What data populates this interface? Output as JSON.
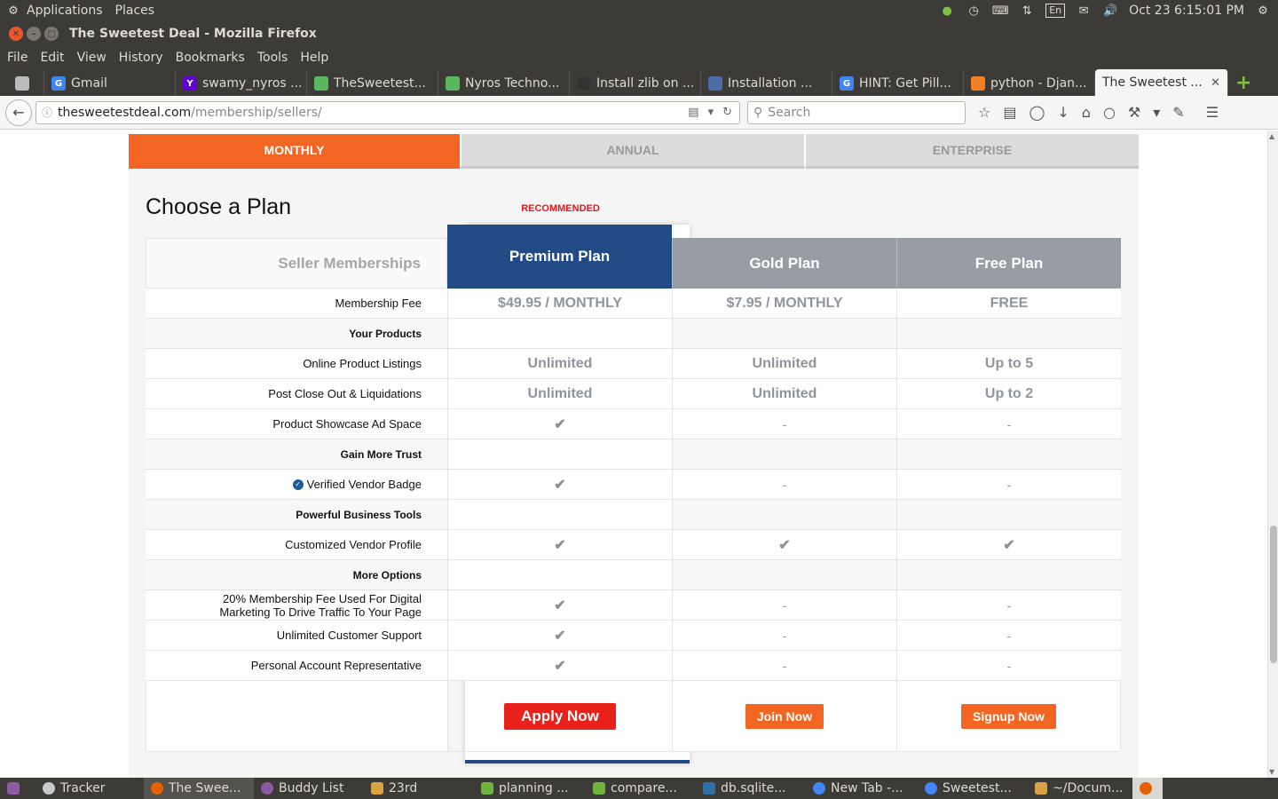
{
  "panel": {
    "menus": [
      "Applications",
      "Places"
    ],
    "keyboard_layout": "En",
    "datetime": "Oct 23  6:15:01 PM"
  },
  "window": {
    "title": "The Sweetest Deal - Mozilla Firefox"
  },
  "menubar": [
    "File",
    "Edit",
    "View",
    "History",
    "Bookmarks",
    "Tools",
    "Help"
  ],
  "tabs": [
    {
      "label": "Gmail",
      "icon": "google-icon",
      "color": "#4285f4"
    },
    {
      "label": "swamy_nyros ...",
      "icon": "yahoo-icon",
      "color": "#5f01d1"
    },
    {
      "label": "TheSweetest...",
      "icon": "cloud-icon",
      "color": "#5cb85c"
    },
    {
      "label": "Nyros Techno...",
      "icon": "cloud-icon",
      "color": "#5cb85c"
    },
    {
      "label": "Install zlib on ...",
      "icon": "github-icon",
      "color": "#333333"
    },
    {
      "label": "Installation ...",
      "icon": "doc-icon",
      "color": "#4a6da7"
    },
    {
      "label": "HINT: Get Pill...",
      "icon": "google-icon",
      "color": "#4285f4"
    },
    {
      "label": "python - Djan...",
      "icon": "stackoverflow-icon",
      "color": "#f48024"
    },
    {
      "label": "The Sweetest ...",
      "icon": "page-icon",
      "color": "#999999"
    }
  ],
  "navbar": {
    "url_domain": "thesweetestdeal.com",
    "url_path": "/membership/sellers/",
    "search_placeholder": "Search"
  },
  "plan_tabs": [
    "MONTHLY",
    "ANNUAL",
    "ENTERPRISE"
  ],
  "choose_title": "Choose a Plan",
  "recommended": "RECOMMENDED",
  "table": {
    "header": {
      "label": "Seller Memberships",
      "plans": [
        "Premium Plan",
        "Gold Plan",
        "Free Plan"
      ]
    },
    "rows": [
      {
        "label": "Membership Fee",
        "values": [
          "$49.95 / MONTHLY",
          "$7.95 / MONTHLY",
          "FREE"
        ]
      },
      {
        "label": "Your Products",
        "section": true
      },
      {
        "label": "Online Product Listings",
        "values": [
          "Unlimited",
          "Unlimited",
          "Up to 5"
        ]
      },
      {
        "label": "Post Close Out & Liquidations",
        "values": [
          "Unlimited",
          "Unlimited",
          "Up to 2"
        ]
      },
      {
        "label": "Product Showcase Ad Space",
        "values": [
          "check",
          "-",
          "-"
        ]
      },
      {
        "label": "Gain More Trust",
        "section": true
      },
      {
        "label": "Verified Vendor Badge",
        "values": [
          "check",
          "-",
          "-"
        ],
        "icon": "verified-icon"
      },
      {
        "label": "Powerful Business Tools",
        "section": true
      },
      {
        "label": "Customized Vendor Profile",
        "values": [
          "check",
          "check",
          "check"
        ]
      },
      {
        "label": "More Options",
        "section": true
      },
      {
        "label_lines": [
          "20% Membership Fee Used For Digital",
          "Marketing To Drive Traffic To Your Page"
        ],
        "values": [
          "check",
          "-",
          "-"
        ]
      },
      {
        "label": "Unlimited Customer Support",
        "values": [
          "check",
          "-",
          "-"
        ]
      },
      {
        "label": "Personal Account Representative",
        "values": [
          "check",
          "-",
          "-"
        ]
      }
    ],
    "buttons": [
      "Apply Now",
      "Join Now",
      "Signup Now"
    ]
  },
  "taskbar": [
    {
      "label": "Tracker",
      "color": "#c9c9c9"
    },
    {
      "label": "The Swee...",
      "color": "#e66000"
    },
    {
      "label": "Buddy List",
      "color": "#8d5ba6"
    },
    {
      "label": "23rd",
      "color": "#d9a441"
    },
    {
      "label": "planning ...",
      "color": "#6fb33f"
    },
    {
      "label": "compare...",
      "color": "#6fb33f"
    },
    {
      "label": "db.sqlite...",
      "color": "#2f6fa8"
    },
    {
      "label": "New Tab -...",
      "color": "#4285f4"
    },
    {
      "label": "Sweetest...",
      "color": "#4285f4"
    },
    {
      "label": "~/Docum...",
      "color": "#d8a144"
    }
  ],
  "colors": {
    "accent_orange": "#f26522",
    "premium_blue": "#224b86",
    "apply_red": "#e8211b",
    "header_grey": "#979da2"
  }
}
